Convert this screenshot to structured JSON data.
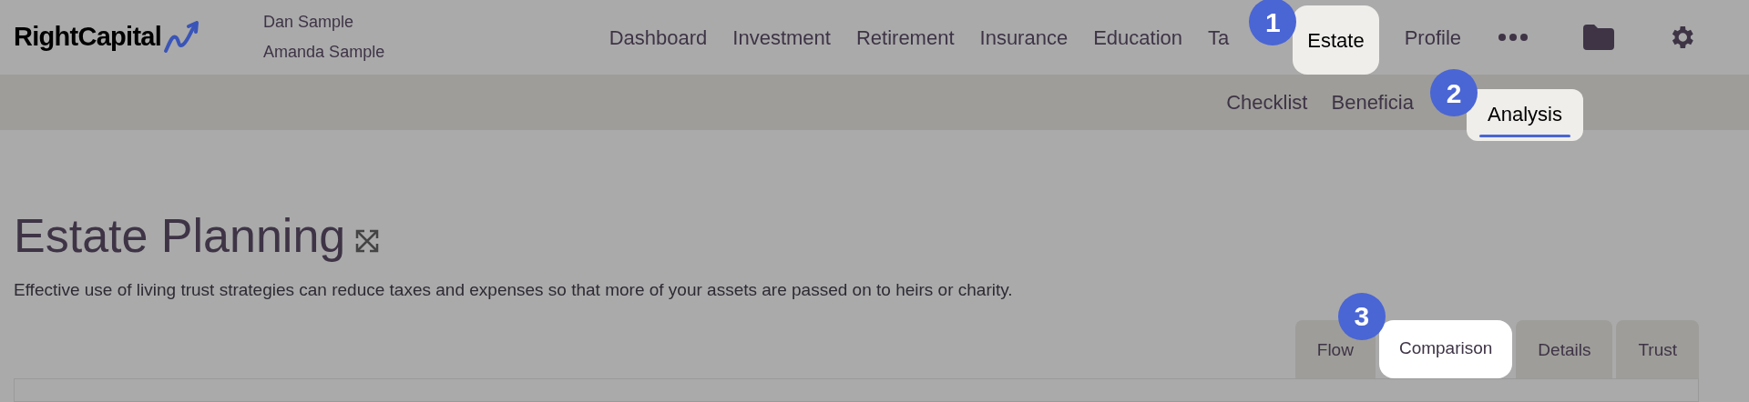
{
  "header": {
    "logo": "RightCapital",
    "clients": [
      "Dan Sample",
      "Amanda Sample"
    ]
  },
  "nav_items": [
    {
      "label": "Dashboard",
      "selected": false
    },
    {
      "label": "Investment",
      "selected": false
    },
    {
      "label": "Retirement",
      "selected": false
    },
    {
      "label": "Insurance",
      "selected": false
    },
    {
      "label": "Education",
      "selected": false
    },
    {
      "label": "Ta",
      "selected": false
    },
    {
      "label": "Estate",
      "selected": true,
      "step": "1"
    },
    {
      "label": "Profile",
      "selected": false
    }
  ],
  "subnav_items": [
    {
      "label": "Checklist",
      "selected": false
    },
    {
      "label": "Beneficia",
      "selected": false
    },
    {
      "label": "Analysis",
      "selected": true,
      "step": "2"
    }
  ],
  "page": {
    "title": "Estate Planning",
    "description": "Effective use of living trust strategies can reduce taxes and expenses so that more of your assets are passed on to heirs or charity."
  },
  "tabs": [
    {
      "label": "Flow",
      "selected": false
    },
    {
      "label": "Comparison",
      "selected": true,
      "step": "3"
    },
    {
      "label": "Details",
      "selected": false
    },
    {
      "label": "Trust",
      "selected": false
    }
  ]
}
